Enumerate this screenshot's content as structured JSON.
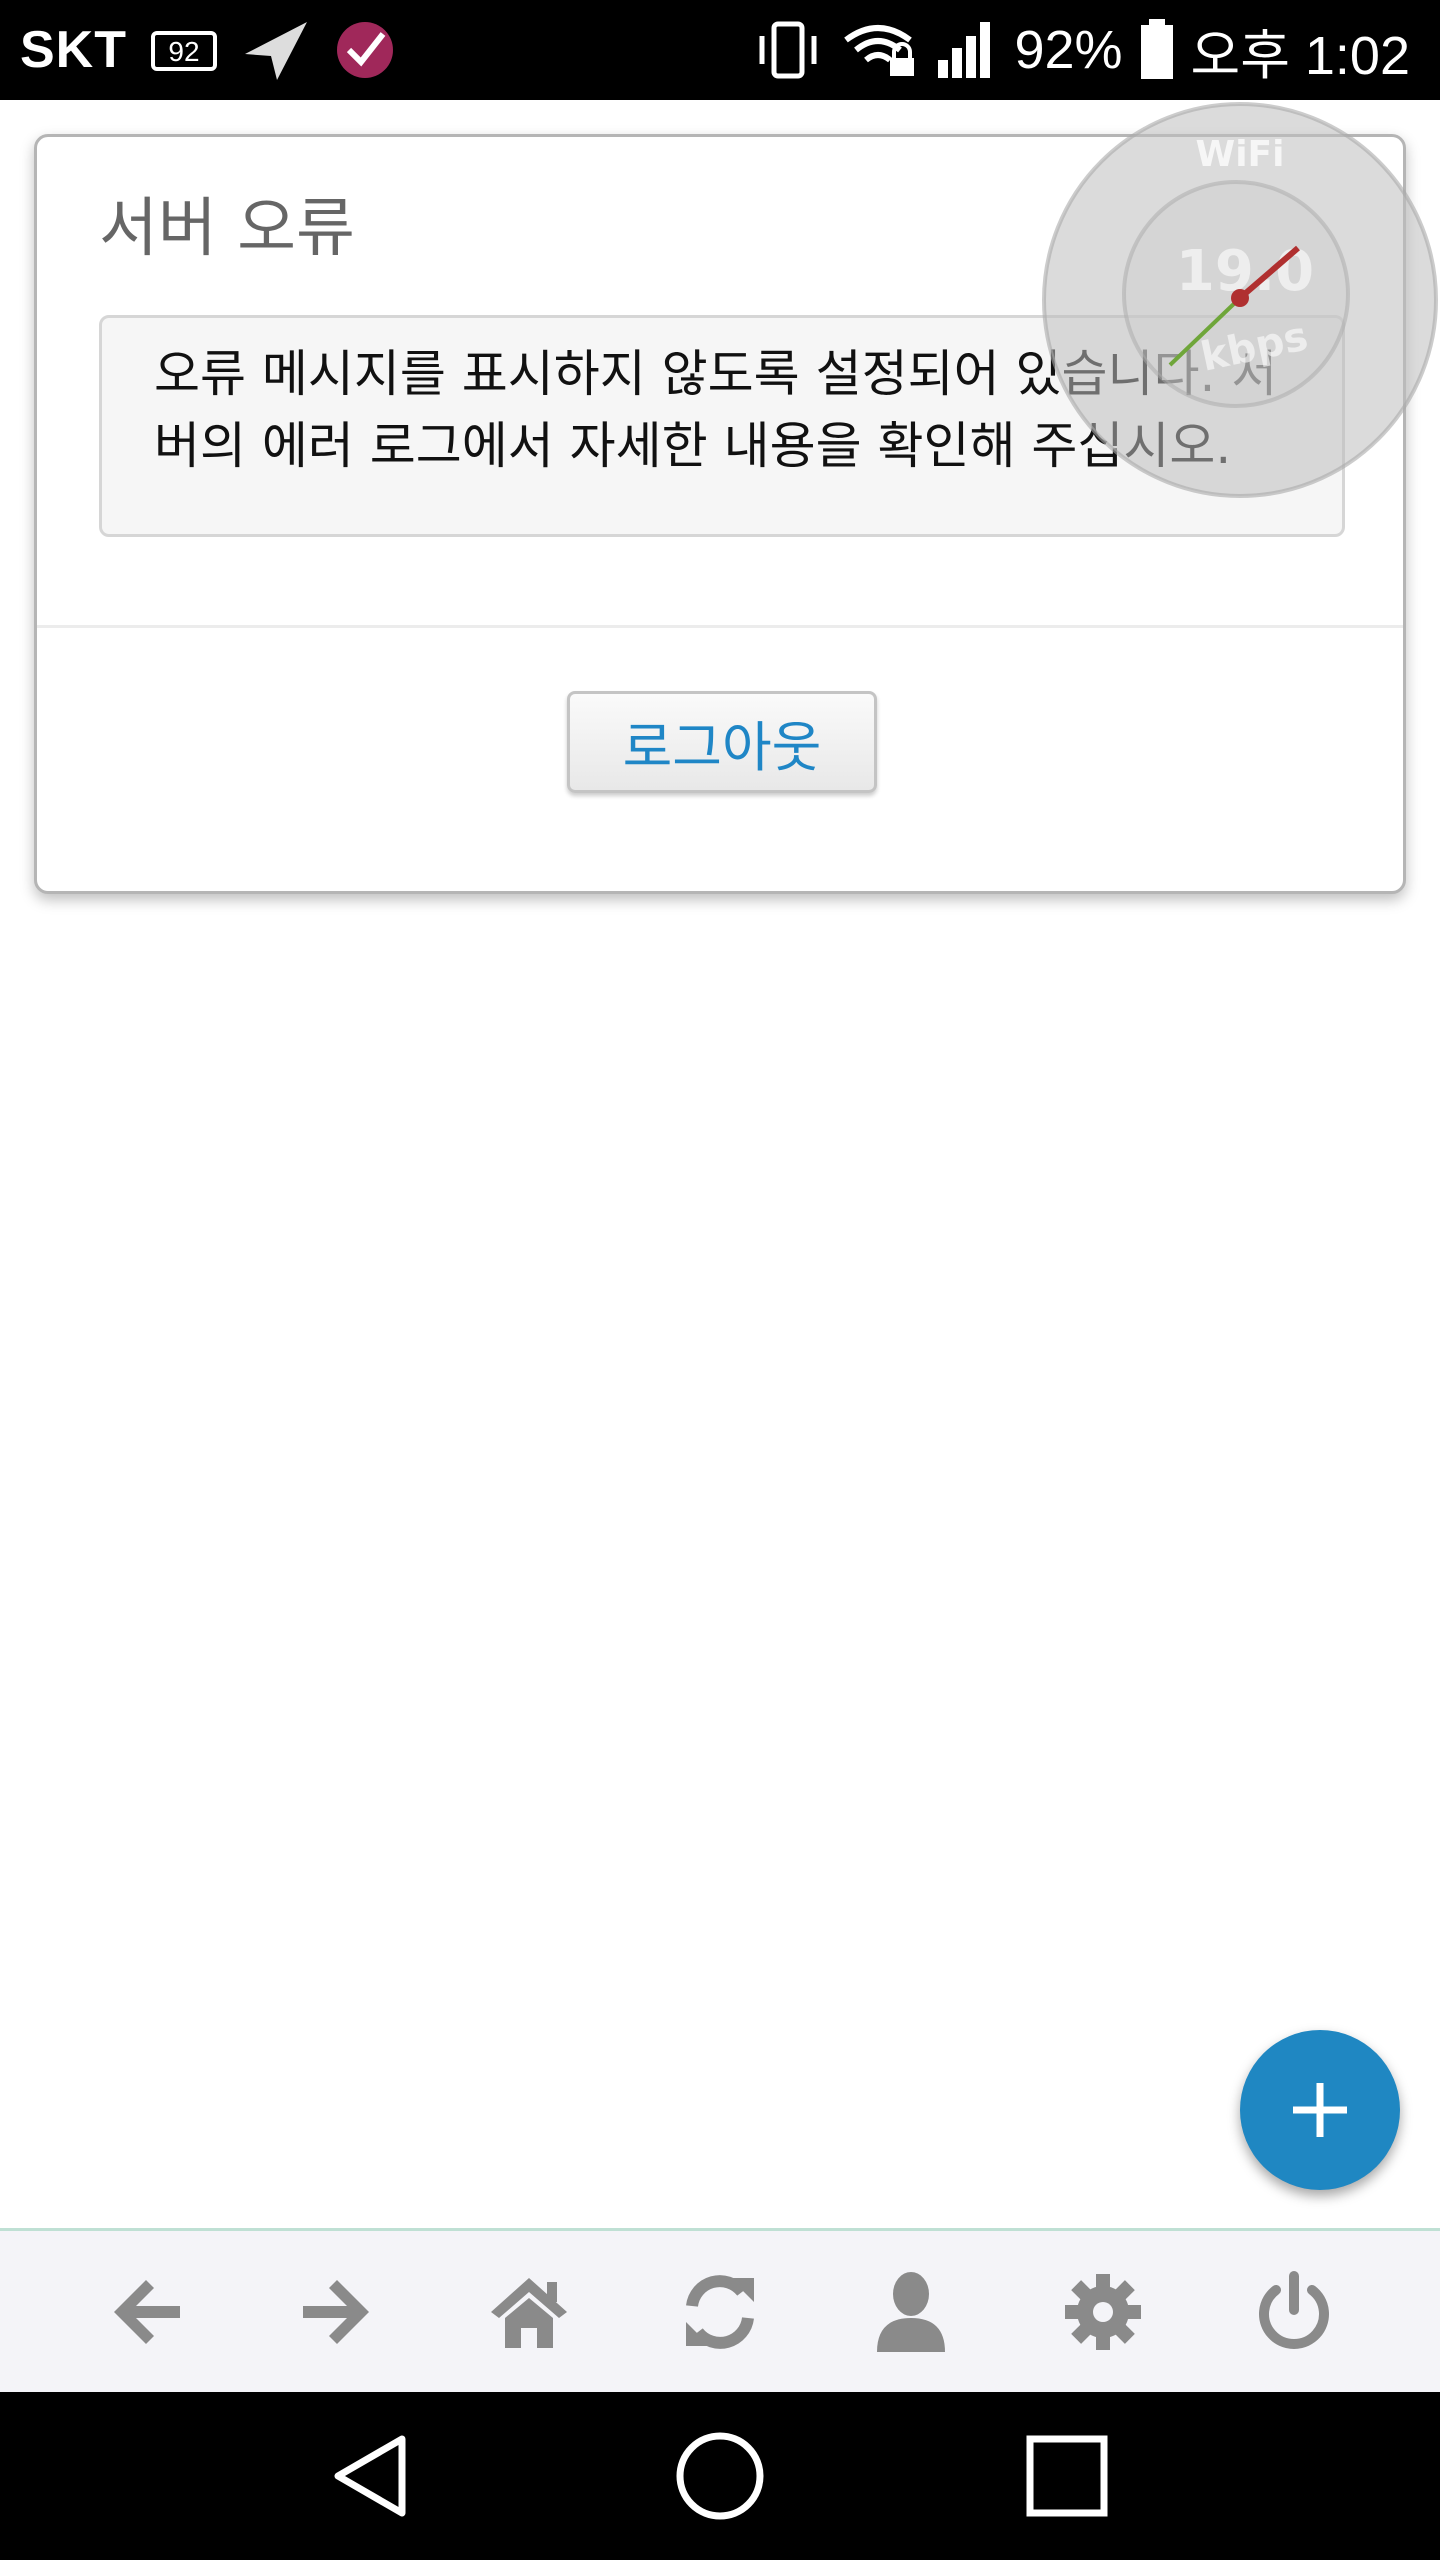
{
  "status_bar": {
    "carrier": "SKT",
    "badge": "92",
    "battery_percent": "92%",
    "time": "오후 1:02",
    "icons": [
      "notification-badge-icon",
      "send-icon",
      "app-check-icon",
      "vibrate-icon",
      "wifi-lock-icon",
      "signal-icon",
      "battery-icon"
    ]
  },
  "dialog": {
    "title": "서버 오류",
    "message": "오류 메시지를 표시하지 않도록 설정되어 있습니다. 서버의 에러 로그에서 자세한 내용을 확인해 주십시오.",
    "logout_label": "로그아웃"
  },
  "speed_widget": {
    "label": "WiFi",
    "value": "19.0",
    "unit": "kbps"
  },
  "fab": {
    "icon": "plus-icon"
  },
  "toolbar": {
    "items": [
      "back-arrow-icon",
      "forward-arrow-icon",
      "home-icon",
      "refresh-icon",
      "user-icon",
      "settings-icon",
      "power-icon"
    ]
  },
  "navbar": {
    "items": [
      "back-triangle-icon",
      "home-circle-icon",
      "recents-square-icon"
    ]
  },
  "colors": {
    "accent": "#1f87c2",
    "link_text": "#1f86c6",
    "toolbar_icon": "#8a8a8a"
  }
}
